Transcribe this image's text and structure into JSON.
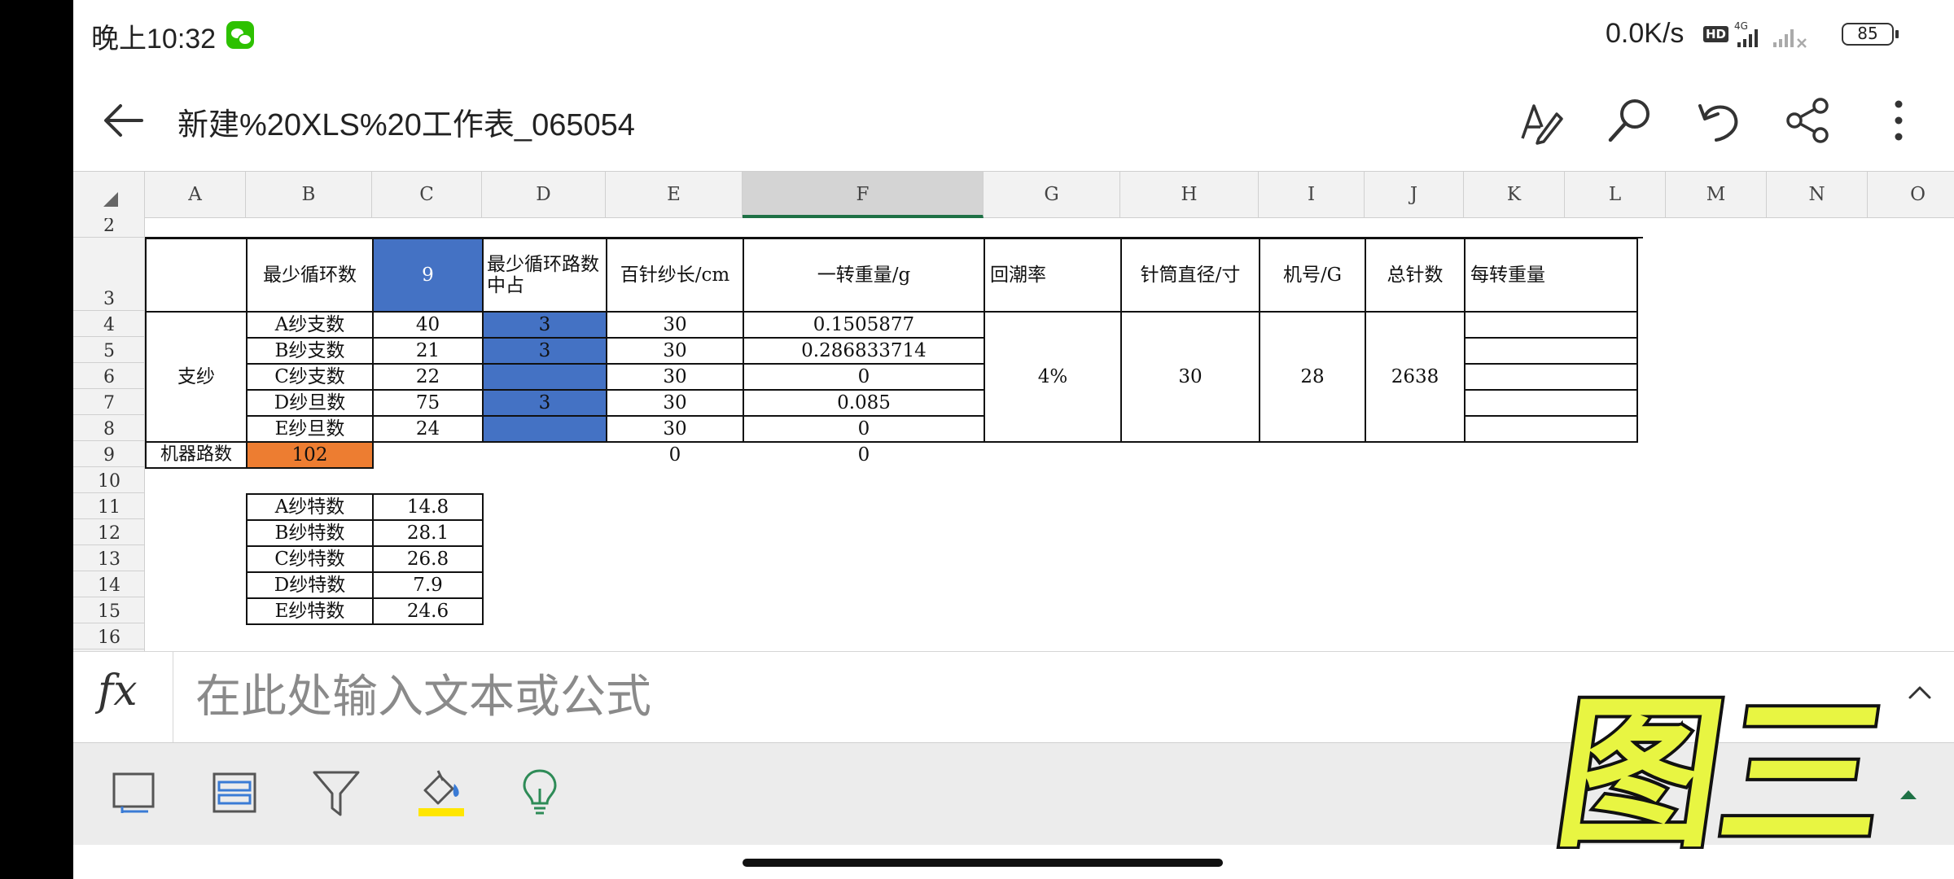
{
  "status_bar": {
    "time": "晚上10:32",
    "network_speed": "0.0K/s",
    "hd_badge": "HD",
    "battery": "85"
  },
  "app_bar": {
    "title": "新建%20XLS%20工作表_065054"
  },
  "columns": [
    "A",
    "B",
    "C",
    "D",
    "E",
    "F",
    "G",
    "H",
    "I",
    "J",
    "K",
    "L",
    "M",
    "N",
    "O"
  ],
  "active_column": "F",
  "rows": [
    "2",
    "3",
    "4",
    "5",
    "6",
    "7",
    "8",
    "9",
    "10",
    "11",
    "12",
    "13",
    "14",
    "15",
    "16"
  ],
  "sheet": {
    "header_row": {
      "b": "最少循环数",
      "c": "9",
      "d": "最少循环路数中占",
      "e": "百针纱长/cm",
      "f": "一转重量/g",
      "g": "回潮率",
      "h": "针筒直径/寸",
      "i": "机号/G",
      "j": "总针数",
      "k": "每转重量"
    },
    "group_label": "支纱",
    "yarn_rows": [
      {
        "b": "A纱支数",
        "c": "40",
        "d": "3",
        "e": "30",
        "f": "0.1505877"
      },
      {
        "b": "B纱支数",
        "c": "21",
        "d": "3",
        "e": "30",
        "f": "0.286833714"
      },
      {
        "b": "C纱支数",
        "c": "22",
        "d": "",
        "e": "30",
        "f": "0"
      },
      {
        "b": "D纱旦数",
        "c": "75",
        "d": "3",
        "e": "30",
        "f": "0.085"
      },
      {
        "b": "E纱旦数",
        "c": "24",
        "d": "",
        "e": "30",
        "f": "0"
      }
    ],
    "merged": {
      "moisture": "4%",
      "diameter": "30",
      "gauge": "28",
      "needles": "2638"
    },
    "machine_row": {
      "label": "机器路数",
      "value": "102",
      "e": "0",
      "f": "0"
    },
    "tex_rows": [
      {
        "label": "A纱特数",
        "value": "14.8"
      },
      {
        "label": "B纱特数",
        "value": "28.1"
      },
      {
        "label": "C纱特数",
        "value": "26.8"
      },
      {
        "label": "D纱特数",
        "value": "7.9"
      },
      {
        "label": "E纱特数",
        "value": "24.6"
      }
    ]
  },
  "formula_bar": {
    "fx": "fx",
    "placeholder": "在此处输入文本或公式"
  },
  "overlay": {
    "text": "图三"
  },
  "colors": {
    "blue_fill": "#4472c4",
    "orange_fill": "#ed7d31",
    "active_column_underline": "#1e7145",
    "overlay_fill": "#e8f542"
  }
}
